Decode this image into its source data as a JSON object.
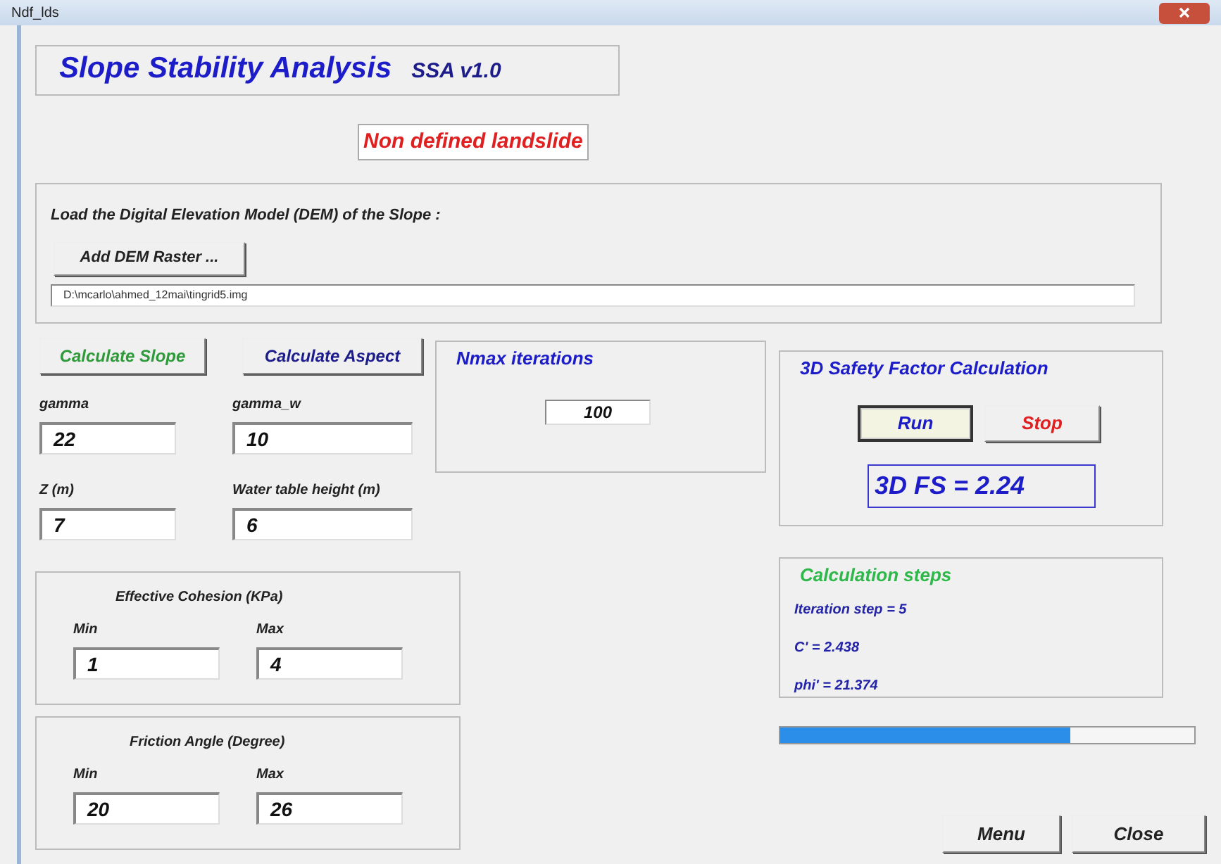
{
  "window": {
    "title": "Ndf_lds"
  },
  "app_title": {
    "name": "Slope Stability Analysis",
    "version": "SSA  v1.0"
  },
  "status_label": "Non defined landslide",
  "dem": {
    "prompt": "Load the Digital Elevation Model (DEM) of the Slope :",
    "button": "Add DEM Raster ...",
    "path": "D:\\mcarlo\\ahmed_12mai\\tingrid5.img"
  },
  "action_buttons": [
    {
      "label": "Calculate Slope",
      "color": "#2e9a3a"
    },
    {
      "label": "Calculate Aspect",
      "color": "#1c1c8a"
    }
  ],
  "parameters": [
    {
      "label": "gamma",
      "value": "22"
    },
    {
      "label": "gamma_w",
      "value": "10"
    },
    {
      "label": "Z (m)",
      "value": "7"
    },
    {
      "label": "Water table height (m)",
      "value": "6"
    }
  ],
  "ranges": [
    {
      "title": "Effective Cohesion (KPa)",
      "min_label": "Min",
      "min_value": "1",
      "max_label": "Max",
      "max_value": "4"
    },
    {
      "title": "Friction Angle (Degree)",
      "min_label": "Min",
      "min_value": "20",
      "max_label": "Max",
      "max_value": "26"
    }
  ],
  "nmax": {
    "title": "Nmax iterations",
    "value": "100"
  },
  "safety": {
    "title": "3D Safety Factor Calculation",
    "buttons": [
      {
        "label": "Run",
        "color": "#1c1cc8",
        "default": true
      },
      {
        "label": "Stop",
        "color": "#e02020",
        "default": false
      }
    ],
    "result": "3D FS = 2.24"
  },
  "steps": {
    "title": "Calculation steps",
    "lines": [
      "Iteration step = 5",
      "C' = 2.438",
      "phi' = 21.374"
    ]
  },
  "progress": {
    "level": 0.7
  },
  "footer_buttons": [
    "Menu",
    "Close"
  ]
}
